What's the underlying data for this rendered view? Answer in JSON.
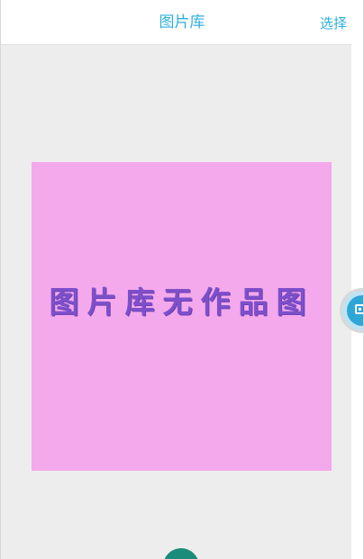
{
  "header": {
    "title": "图片库",
    "select_label": "选择"
  },
  "gallery": {
    "empty_placeholder_text": "图片库无作品图",
    "placeholder_color": "#f4a9ec",
    "placeholder_text_color": "#7d50c9"
  },
  "colors": {
    "accent": "#2fb0dc",
    "content_background": "#ededed",
    "floating_button": "#2fa6d8",
    "bottom_button": "#1b8c7a"
  },
  "icons": {
    "floating_button_icon": "square-frame-icon",
    "bottom_button_icon": "circle-action-icon"
  }
}
